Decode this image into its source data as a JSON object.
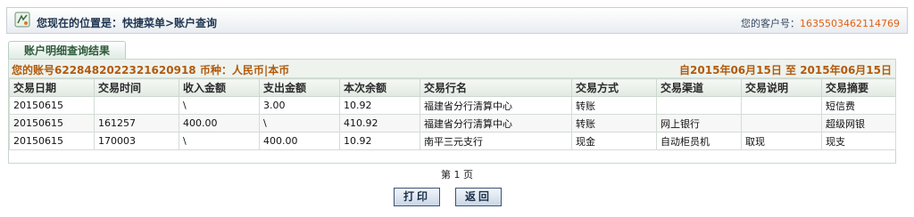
{
  "header": {
    "location_text": "您现在的位置是：快捷菜单>账户查询",
    "customer_label": "您的客户号：",
    "customer_no": "1635503462114769"
  },
  "tab": {
    "label": "账户明细查询结果"
  },
  "account_bar": {
    "account_info": "您的账号6228482022321620918 币种：人民币|本币",
    "date_range": "自2015年06月15日  至  2015年06月15日"
  },
  "table": {
    "headers": [
      "交易日期",
      "交易时间",
      "收入金额",
      "支出金额",
      "本次余额",
      "交易行名",
      "交易方式",
      "交易渠道",
      "交易说明",
      "交易摘要"
    ],
    "rows": [
      [
        "20150615",
        "",
        "\\",
        "3.00",
        "10.92",
        "福建省分行清算中心",
        "转账",
        "",
        "",
        "短信费"
      ],
      [
        "20150615",
        "161257",
        "400.00",
        "\\",
        "410.92",
        "福建省分行清算中心",
        "转账",
        "网上银行",
        "",
        "超级网银"
      ],
      [
        "20150615",
        "170003",
        "\\",
        "400.00",
        "10.92",
        "南平三元支行",
        "现金",
        "自动柜员机",
        "取现",
        "现支"
      ]
    ]
  },
  "pager": {
    "text": "第 1 页"
  },
  "buttons": {
    "print": "打印",
    "back": "返回"
  },
  "icons": {
    "location": "location-pin-icon"
  },
  "colors": {
    "account_text": "#b25a0c",
    "customer_no": "#e25e13",
    "button_border": "#3a5472"
  }
}
